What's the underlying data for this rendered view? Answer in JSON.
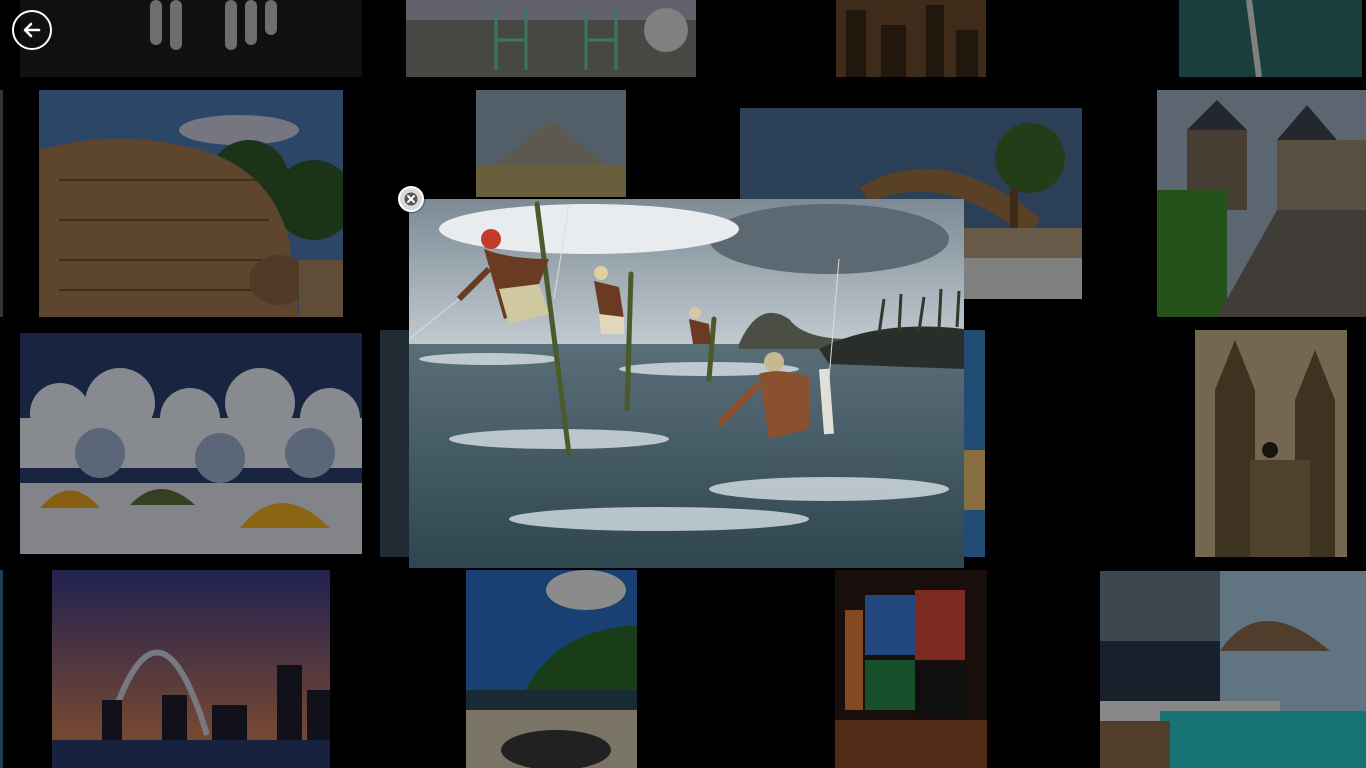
{
  "app": {
    "back_icon": "back-arrow-icon",
    "close_icon": "close-icon"
  },
  "grid": {
    "tiles": [
      {
        "subject": "hands"
      },
      {
        "subject": "cafe-chairs"
      },
      {
        "subject": "city-aerial"
      },
      {
        "subject": "coast-road"
      },
      {
        "subject": "rock-carvings"
      },
      {
        "subject": "pyramid"
      },
      {
        "subject": "thatched-cabana"
      },
      {
        "subject": "medieval-village"
      },
      {
        "subject": "clouds-camp"
      },
      {
        "subject": "partial-tile"
      },
      {
        "subject": "partial-tile"
      },
      {
        "subject": "gothic-church"
      },
      {
        "subject": "gateway-arch"
      },
      {
        "subject": "beach-palms"
      },
      {
        "subject": "times-square"
      },
      {
        "subject": "overwater-villa"
      }
    ]
  },
  "viewer": {
    "subject": "stilt-fishermen"
  }
}
